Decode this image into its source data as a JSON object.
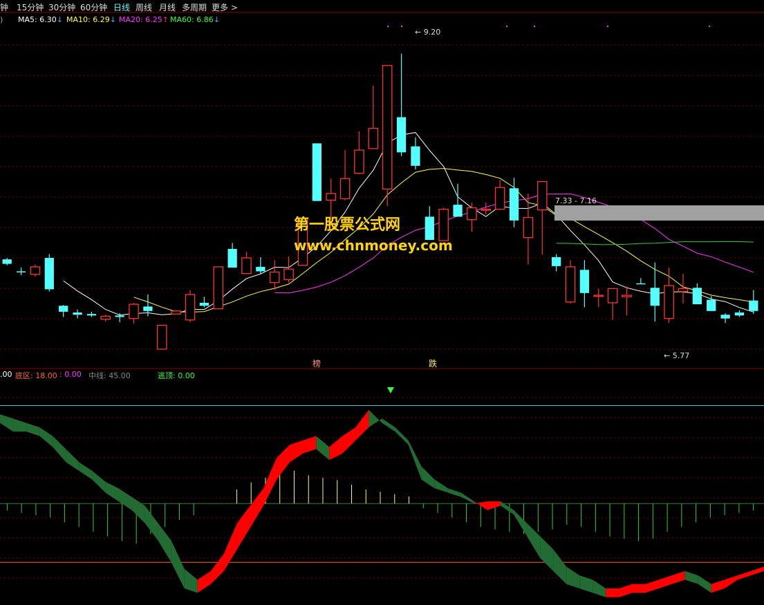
{
  "periods": {
    "items": [
      "钟",
      "15分钟",
      "30分钟",
      "60分钟",
      "日线",
      "周线",
      "月线",
      "多周期",
      "更多"
    ],
    "more_arrow": ">",
    "active": "日线"
  },
  "ma_legend": {
    "prefix": ")",
    "items": [
      {
        "label": "MA5: 6.30",
        "arrow": "↓",
        "color": "#ffffff",
        "arrow_color": "#4aa8ff"
      },
      {
        "label": "MA10: 6.29",
        "arrow": "↓",
        "color": "#ffff33",
        "arrow_color": "#4aa8ff"
      },
      {
        "label": "MA20: 6.25",
        "arrow": "↑",
        "color": "#ff33ff",
        "arrow_color": "#ff3333"
      },
      {
        "label": "MA60: 6.86",
        "arrow": "↓",
        "color": "#33ff33",
        "arrow_color": "#4aa8ff"
      }
    ]
  },
  "indicator_legend": {
    "items": [
      {
        "text": ".00",
        "color": "#ffffff"
      },
      {
        "text": "底区: 18.00",
        "color": "#ff6633"
      },
      {
        "text": ": 0.00",
        "color": "#ff33ff"
      },
      {
        "text": "中线: 45.00",
        "color": "#888888"
      },
      {
        "text": "逃顶: 0.00",
        "color": "#33ff33"
      }
    ]
  },
  "annotations": {
    "high_label": "9.20",
    "low_label": "5.77",
    "range_label": "7.33 - 7.16",
    "bottom_mark_1": "榜",
    "bottom_mark_2": "跌"
  },
  "watermark": {
    "line1": "第一股票公式网",
    "line2": "www.chnmoney.com"
  },
  "chart_data": {
    "type": "candlestick",
    "upColor": "#ff3333",
    "downColor": "#54ffff",
    "candles": [
      [
        6.45,
        6.39,
        6.47,
        6.37
      ],
      [
        6.29,
        6.28,
        6.34,
        6.24
      ],
      [
        6.25,
        6.35,
        6.38,
        6.22
      ],
      [
        6.47,
        6.05,
        6.52,
        6.02
      ],
      [
        5.83,
        5.75,
        5.84,
        5.68
      ],
      [
        5.74,
        5.71,
        5.78,
        5.66
      ],
      [
        5.72,
        5.7,
        5.75,
        5.68
      ],
      [
        5.65,
        5.69,
        5.71,
        5.62
      ],
      [
        5.7,
        5.68,
        5.73,
        5.61
      ],
      [
        5.66,
        5.85,
        5.87,
        5.59
      ],
      [
        5.82,
        5.76,
        5.98,
        5.69
      ],
      [
        5.25,
        5.57,
        5.57,
        5.25
      ],
      [
        5.72,
        5.76,
        5.77,
        5.72
      ],
      [
        5.64,
        5.98,
        6.04,
        5.61
      ],
      [
        5.87,
        5.83,
        5.95,
        5.81
      ],
      [
        5.79,
        6.35,
        6.35,
        5.78
      ],
      [
        6.59,
        6.34,
        6.67,
        6.34
      ],
      [
        6.26,
        6.47,
        6.55,
        6.27
      ],
      [
        6.35,
        6.29,
        6.48,
        6.25
      ],
      [
        6.14,
        6.28,
        6.44,
        6.04
      ],
      [
        6.18,
        6.32,
        6.49,
        6.14
      ],
      [
        6.37,
        7.0,
        7.0,
        6.37
      ],
      [
        8.0,
        7.23,
        8.0,
        7.23
      ],
      [
        7.24,
        7.33,
        7.53,
        6.98
      ],
      [
        7.26,
        7.53,
        7.91,
        7.24
      ],
      [
        7.6,
        7.91,
        8.16,
        7.59
      ],
      [
        7.93,
        8.2,
        8.77,
        7.93
      ],
      [
        7.39,
        9.04,
        9.04,
        7.16
      ],
      [
        8.35,
        7.88,
        9.2,
        7.83
      ],
      [
        7.96,
        7.7,
        8.08,
        7.65
      ],
      [
        7.02,
        6.71,
        7.16,
        6.71
      ],
      [
        6.7,
        7.12,
        7.14,
        6.7
      ],
      [
        7.18,
        7.02,
        7.46,
        7.02
      ],
      [
        6.98,
        7.14,
        7.21,
        6.82
      ],
      [
        7.11,
        7.12,
        7.21,
        7.05
      ],
      [
        7.12,
        7.41,
        7.51,
        7.11
      ],
      [
        7.4,
        6.97,
        7.54,
        6.88
      ],
      [
        6.74,
        7.01,
        7.33,
        6.38
      ],
      [
        7.11,
        7.49,
        7.33,
        6.51
      ],
      [
        6.48,
        6.36,
        6.52,
        6.29
      ],
      [
        5.88,
        6.35,
        6.44,
        5.86
      ],
      [
        6.31,
        6.0,
        6.44,
        5.81
      ],
      [
        5.97,
        5.97,
        6.06,
        5.81
      ],
      [
        5.87,
        6.06,
        6.06,
        5.64
      ],
      [
        5.95,
        5.97,
        6.09,
        5.7
      ],
      [
        6.13,
        6.12,
        6.2,
        6.12
      ],
      [
        6.07,
        5.83,
        6.41,
        5.62
      ],
      [
        5.66,
        6.1,
        6.34,
        5.6
      ],
      [
        6.02,
        6.06,
        6.26,
        5.86
      ],
      [
        6.07,
        5.85,
        6.13,
        5.91
      ],
      [
        5.91,
        5.76,
        5.96,
        5.76
      ],
      [
        5.71,
        5.66,
        5.73,
        5.6
      ],
      [
        5.74,
        5.7,
        5.77,
        5.68
      ],
      [
        5.9,
        5.76,
        6.04,
        5.72
      ]
    ],
    "ma_visible": [
      "MA5",
      "MA10",
      "MA20",
      "MA60"
    ],
    "ylim": [
      5.25,
      9.5
    ],
    "indicator": {
      "ylim": [
        0,
        100
      ],
      "upper_line": 90,
      "mid_line": 45,
      "lower_line": 18,
      "band_top": [
        86,
        84,
        82,
        80,
        76,
        70,
        64,
        60,
        55,
        52,
        48,
        44,
        36,
        28,
        15,
        10,
        14,
        22,
        36,
        44,
        52,
        66,
        72,
        74,
        76,
        71,
        76,
        80,
        88,
        82,
        78,
        72,
        56,
        52,
        50,
        48,
        45,
        46,
        46,
        42,
        36,
        30,
        24,
        16,
        12,
        10,
        6,
        6,
        8,
        8,
        10,
        12,
        14,
        12,
        8,
        10,
        12,
        14,
        16
      ],
      "band_bottom": [
        82,
        78,
        78,
        76,
        71,
        64,
        60,
        56,
        50,
        46,
        42,
        36,
        28,
        18,
        6,
        4,
        8,
        14,
        24,
        34,
        44,
        56,
        64,
        68,
        70,
        65,
        68,
        74,
        80,
        84,
        80,
        74,
        62,
        56,
        52,
        50,
        46,
        42,
        44,
        40,
        30,
        20,
        14,
        8,
        6,
        4,
        2,
        2,
        4,
        4,
        6,
        8,
        10,
        8,
        4,
        6,
        10,
        12,
        14
      ],
      "hist": [
        -6,
        -8,
        -10,
        -12,
        -16,
        -20,
        -24,
        -28,
        -32,
        -34,
        -26,
        -20,
        -14,
        -10,
        0,
        0,
        12,
        18,
        22,
        26,
        28,
        24,
        22,
        20,
        16,
        12,
        10,
        8,
        6,
        -4,
        -8,
        -12,
        -16,
        -20,
        -22,
        -24,
        -26,
        -24,
        -22,
        -18,
        -20,
        -24,
        -28,
        -30,
        -32,
        -30,
        -24,
        -20,
        -16,
        -12,
        -10,
        -8,
        -6
      ]
    }
  }
}
